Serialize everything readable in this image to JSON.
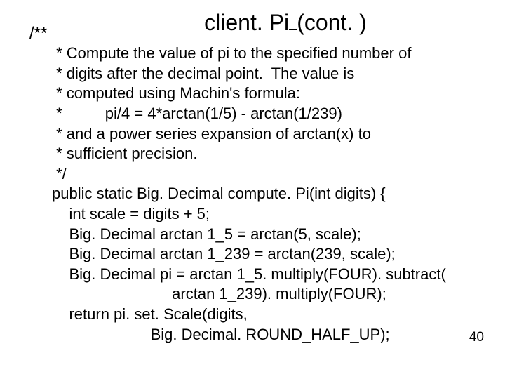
{
  "title_left": "client. Pi",
  "title_right": "(cont. )",
  "opener": "/**",
  "body": " * Compute the value of pi to the specified number of\n * digits after the decimal point.  The value is\n * computed using Machin's formula:\n *          pi/4 = 4*arctan(1/5) - arctan(1/239)\n * and a power series expansion of arctan(x) to\n * sufficient precision.\n */\npublic static Big. Decimal compute. Pi(int digits) {\n    int scale = digits + 5;\n    Big. Decimal arctan 1_5 = arctan(5, scale);\n    Big. Decimal arctan 1_239 = arctan(239, scale);\n    Big. Decimal pi = arctan 1_5. multiply(FOUR). subtract(\n                            arctan 1_239). multiply(FOUR);\n    return pi. set. Scale(digits,\n                       Big. Decimal. ROUND_HALF_UP);",
  "pagenum": "40"
}
